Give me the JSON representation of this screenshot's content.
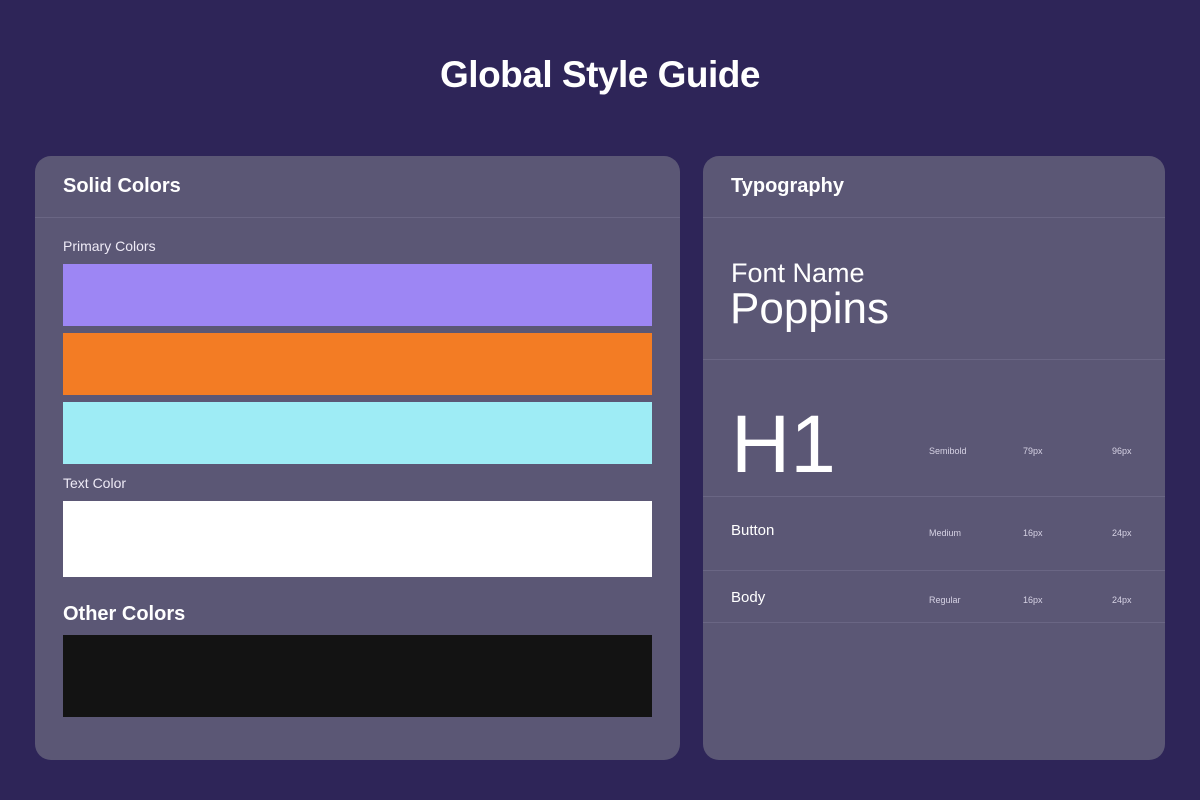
{
  "page": {
    "title": "Global Style Guide"
  },
  "colors": {
    "background": "#2e2558",
    "card": "#5b5775"
  },
  "solid_colors": {
    "title": "Solid Colors",
    "primary_label": "Primary Colors",
    "primary": [
      "#9d86f4",
      "#f37c24",
      "#9eecf5"
    ],
    "text_label": "Text Color",
    "text": [
      "#ffffff"
    ],
    "other_heading": "Other Colors",
    "other": [
      "#131313"
    ]
  },
  "typography": {
    "title": "Typography",
    "font_label": "Font Name",
    "font_name": "Poppins",
    "styles": [
      {
        "name": "H1",
        "weight": "Semibold",
        "size": "79px",
        "line_height": "96px"
      },
      {
        "name": "Button",
        "weight": "Medium",
        "size": "16px",
        "line_height": "24px"
      },
      {
        "name": "Body",
        "weight": "Regular",
        "size": "16px",
        "line_height": "24px"
      }
    ]
  }
}
